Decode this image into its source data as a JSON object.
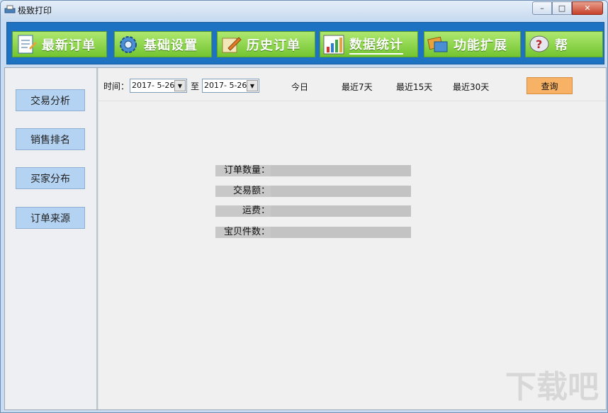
{
  "window": {
    "title": "极致打印",
    "minimize": "–",
    "maximize": "□",
    "close": "✕"
  },
  "nav": [
    {
      "label": "最新订单"
    },
    {
      "label": "基础设置"
    },
    {
      "label": "历史订单"
    },
    {
      "label": "数据统计"
    },
    {
      "label": "功能扩展"
    },
    {
      "label": "帮"
    }
  ],
  "sidebar": [
    {
      "label": "交易分析"
    },
    {
      "label": "销售排名"
    },
    {
      "label": "买家分布"
    },
    {
      "label": "订单来源"
    }
  ],
  "toolbar": {
    "time_label": "时间：",
    "from_date": "2017- 5-26",
    "to_label": "至",
    "to_date": "2017- 5-26",
    "today": "今日",
    "last7": "最近7天",
    "last15": "最近15天",
    "last30": "最近30天",
    "query": "查询",
    "dropdown_arrow": "▼"
  },
  "stats": [
    {
      "label": "订单数量：",
      "value": ""
    },
    {
      "label": "交易额：",
      "value": ""
    },
    {
      "label": "运费：",
      "value": ""
    },
    {
      "label": "宝贝件数：",
      "value": ""
    }
  ],
  "watermark": "下载吧"
}
